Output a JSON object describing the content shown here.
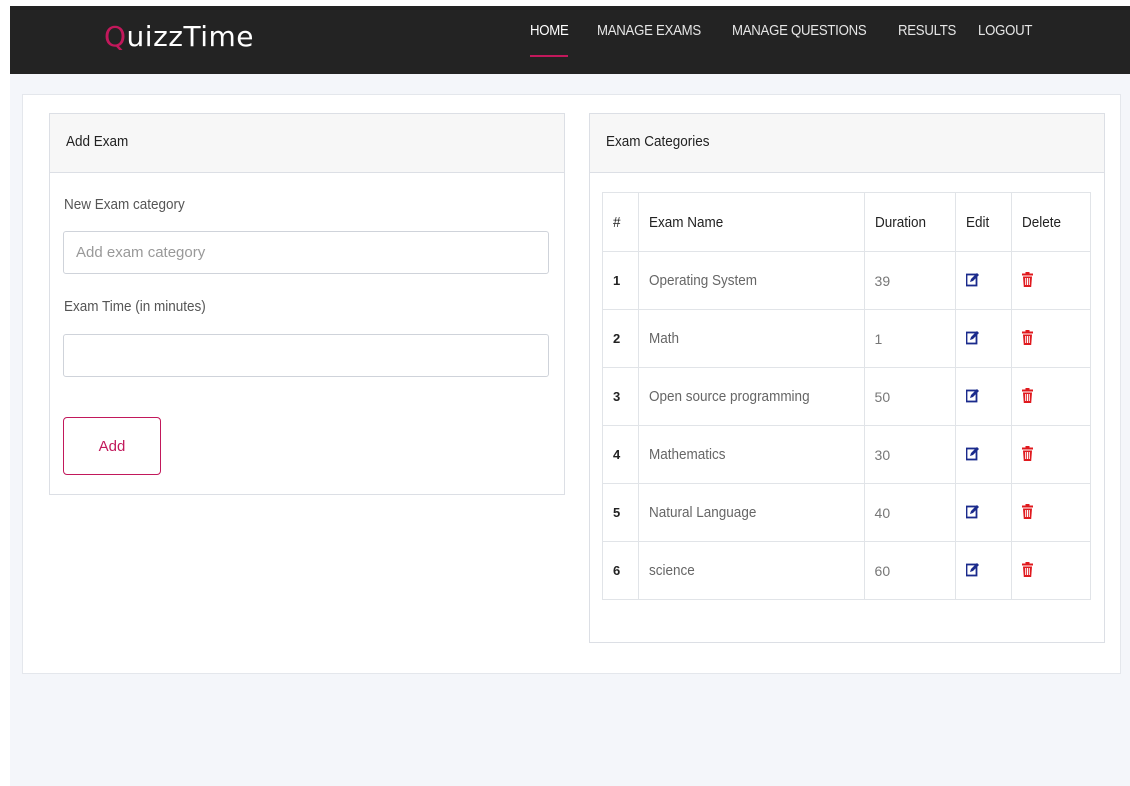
{
  "brand": {
    "first_letter": "Q",
    "rest": "uizzTime"
  },
  "nav": {
    "items": [
      {
        "label": "HOME",
        "active": true
      },
      {
        "label": "MANAGE EXAMS",
        "active": false
      },
      {
        "label": "MANAGE QUESTIONS",
        "active": false
      },
      {
        "label": "RESULTS",
        "active": false
      },
      {
        "label": "LOGOUT",
        "active": false
      }
    ]
  },
  "add_exam": {
    "title": "Add Exam",
    "category_label": "New Exam category",
    "category_placeholder": "Add exam category",
    "category_value": "",
    "time_label": "Exam Time (in minutes)",
    "time_value": "",
    "add_button": "Add"
  },
  "categories": {
    "title": "Exam Categories",
    "columns": [
      "#",
      "Exam Name",
      "Duration",
      "Edit",
      "Delete"
    ],
    "rows": [
      {
        "num": "1",
        "name": "Operating System",
        "duration": "39"
      },
      {
        "num": "2",
        "name": "Math",
        "duration": "1"
      },
      {
        "num": "3",
        "name": "Open source programming",
        "duration": "50"
      },
      {
        "num": "4",
        "name": "Mathematics",
        "duration": "30"
      },
      {
        "num": "5",
        "name": "Natural Language",
        "duration": "40"
      },
      {
        "num": "6",
        "name": "science",
        "duration": "60"
      }
    ],
    "edit_icon": "edit-icon",
    "delete_icon": "trash-icon"
  },
  "colors": {
    "accent": "#c2185b",
    "navbar": "#232323",
    "edit_icon": "#1a2a8c",
    "delete_icon": "#e0191e"
  }
}
